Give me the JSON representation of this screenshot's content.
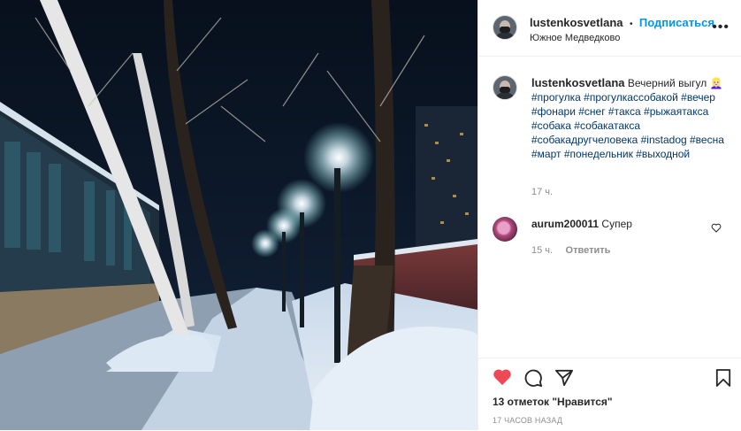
{
  "post": {
    "author": "lustenkosvetlana",
    "follow_label": "Подписаться",
    "separator": "•",
    "location": "Южное Медведково",
    "more_label": "•••"
  },
  "caption": {
    "author": "lustenkosvetlana",
    "text": "Вечерний выгул 👱🏻‍♀️",
    "hashtags": "#прогулка #прогулкассобакой #вечер #фонари #снег #такса #рыжаятакса #собака #собакатакса #собакадругчеловека #instadog #весна #март #понедельник #выходной",
    "time": "17 ч."
  },
  "comment": {
    "author": "aurum200011",
    "text": "Супер",
    "time": "15 ч.",
    "reply_label": "Ответить"
  },
  "footer": {
    "likes": "13 отметок \"Нравится\"",
    "ago": "17 ЧАСОВ НАЗАД"
  },
  "colors": {
    "link": "#0095f6",
    "hashtag": "#00376b",
    "like_red": "#ed4956",
    "secondary": "#8e8e8e"
  },
  "icons": [
    "heart-filled-icon",
    "comment-icon",
    "share-icon",
    "bookmark-icon",
    "heart-outline-icon",
    "more-icon"
  ],
  "photo": {
    "description_hint": "night snowy park alley with street lamps and birch trees"
  }
}
